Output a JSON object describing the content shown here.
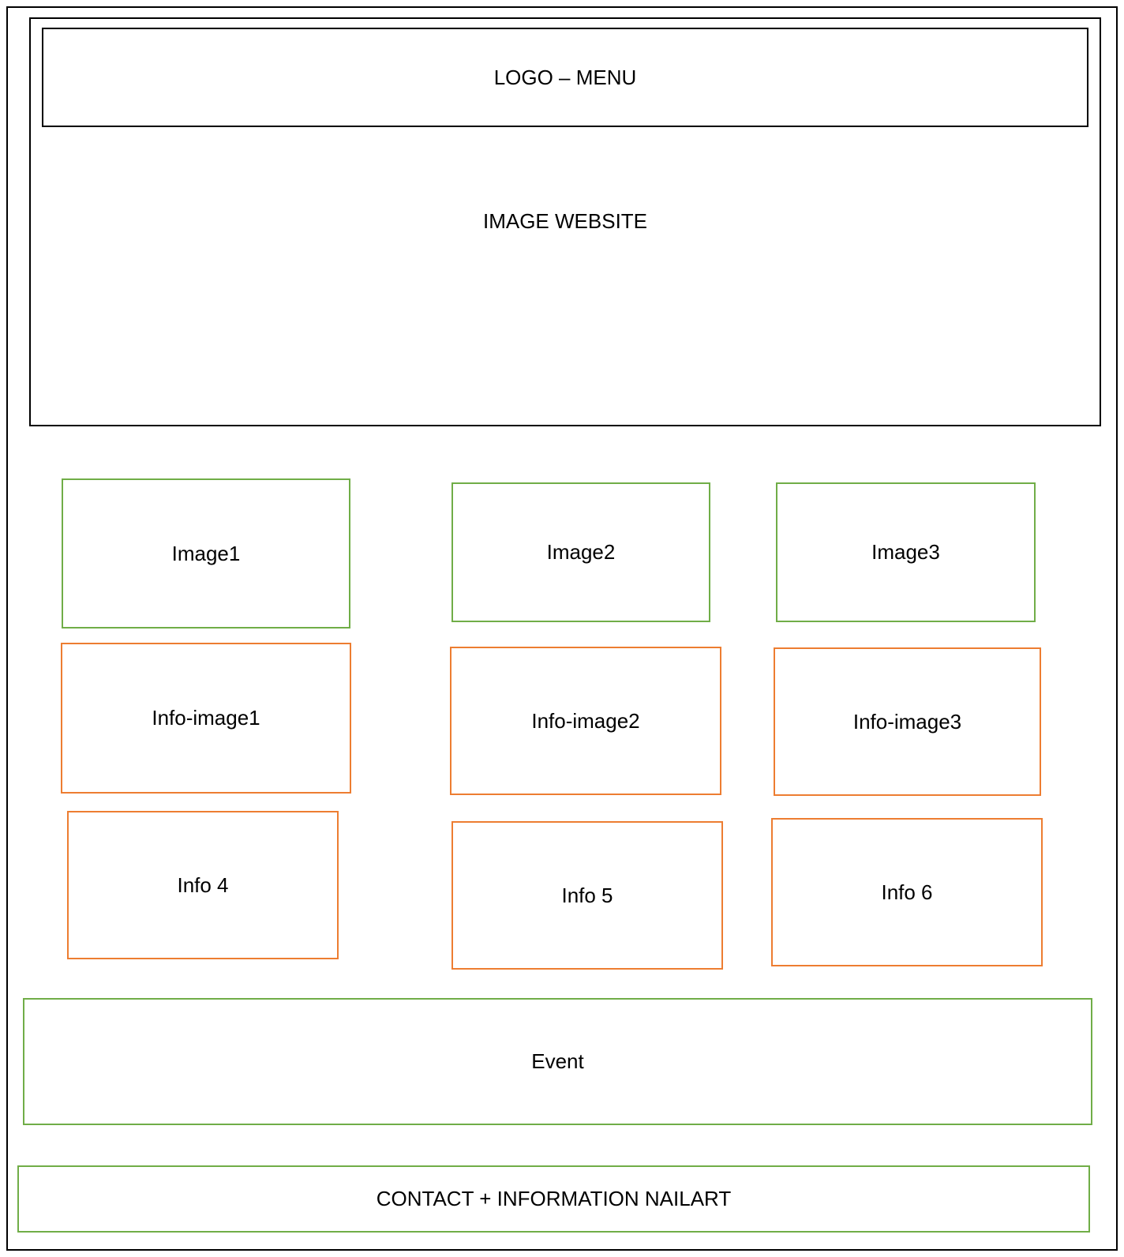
{
  "colors": {
    "outline": "#000000",
    "green": "#70ad47",
    "orange": "#ed7d31"
  },
  "header": {
    "logo_menu": "LOGO – MENU",
    "hero": "IMAGE WEBSITE"
  },
  "images": [
    "Image1",
    "Image2",
    "Image3"
  ],
  "info_images": [
    "Info-image1",
    "Info-image2",
    "Info-image3"
  ],
  "infos": [
    "Info 4",
    "Info 5",
    "Info 6"
  ],
  "event": "Event",
  "footer": "CONTACT + INFORMATION NAILART"
}
